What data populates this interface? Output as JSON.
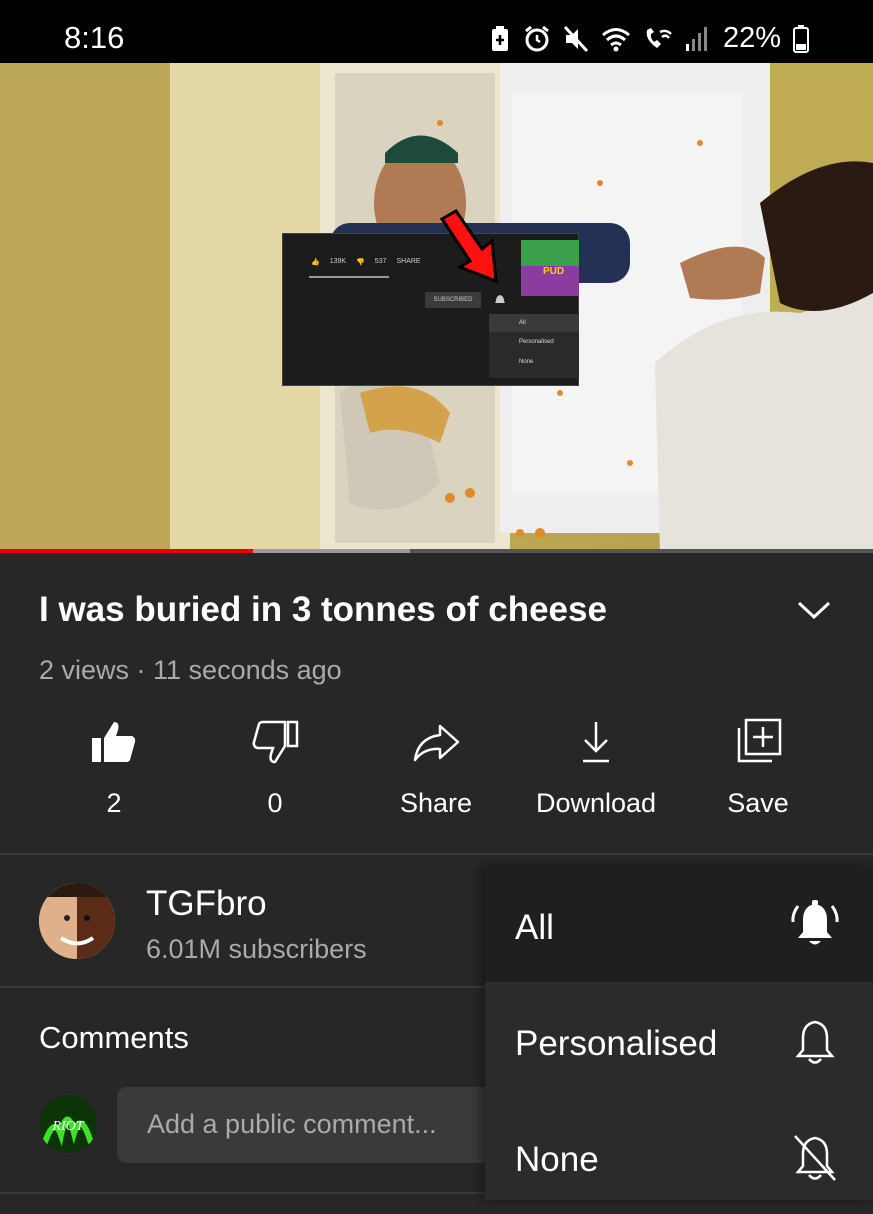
{
  "status_bar": {
    "time": "8:16",
    "battery_percent": "22%",
    "icons": [
      "battery-saver-icon",
      "alarm-icon",
      "mute-vibrate-icon",
      "wifi-icon",
      "wifi-calling-icon",
      "signal-icon",
      "battery-icon"
    ]
  },
  "video": {
    "progress_fraction": 0.29,
    "buffer_fraction": 0.47,
    "thumbnail_overlay": {
      "likes": "139K",
      "dislikes": "537",
      "share": "SHARE",
      "subscribed": "SUBSCRIBED",
      "options": [
        "All",
        "Personalised",
        "None"
      ],
      "thumb_text": "PUD"
    }
  },
  "info": {
    "title": "I was buried in 3 tonnes of cheese",
    "meta": "2 views · 11 seconds ago"
  },
  "actions": {
    "like_count": "2",
    "dislike_count": "0",
    "share_label": "Share",
    "download_label": "Download",
    "save_label": "Save"
  },
  "channel": {
    "name": "TGFbro",
    "subscribers": "6.01M subscribers"
  },
  "comments": {
    "title": "Comments",
    "placeholder": "Add a public comment...",
    "user_avatar_text": "RIOT"
  },
  "notification_menu": {
    "items": [
      {
        "label": "All",
        "icon": "bell-ringing-icon",
        "selected": true
      },
      {
        "label": "Personalised",
        "icon": "bell-icon",
        "selected": false
      },
      {
        "label": "None",
        "icon": "bell-off-icon",
        "selected": false
      }
    ]
  },
  "colors": {
    "background": "#272727",
    "progress": "#ff0000",
    "statusbar": "#000000",
    "menu_selected": "#1f1f1f"
  }
}
